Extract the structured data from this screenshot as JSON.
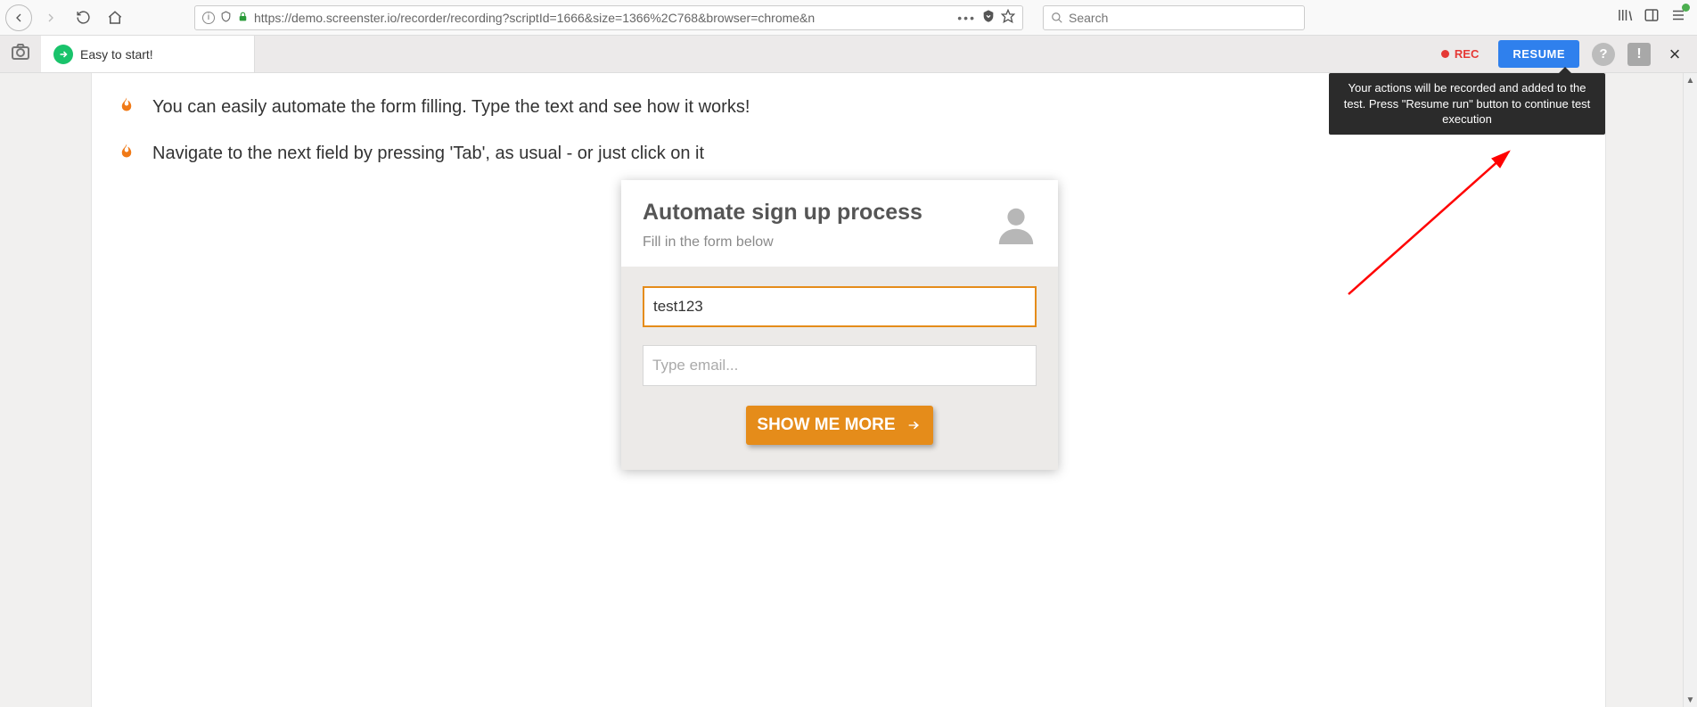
{
  "browser": {
    "url_display": "https://demo.screenster.io/recorder/recording?scriptId=1666&size=1366%2C768&browser=chrome&n",
    "search_placeholder": "Search"
  },
  "toolbar": {
    "easy_label": "Easy to start!",
    "rec_label": "REC",
    "resume_label": "RESUME",
    "help_label": "?",
    "alert_label": "!",
    "close_label": "×"
  },
  "tips": [
    "You can easily automate the form filling. Type the text and see how it works!",
    "Navigate to the next field by pressing 'Tab', as usual - or just click on it"
  ],
  "card": {
    "title": "Automate sign up process",
    "subtitle": "Fill in the form below",
    "name_value": "test123",
    "email_placeholder": "Type email...",
    "button_label": "SHOW ME MORE"
  },
  "tooltip": {
    "text": "Your actions will be recorded and added to the test. Press \"Resume run\" button to continue test execution"
  }
}
